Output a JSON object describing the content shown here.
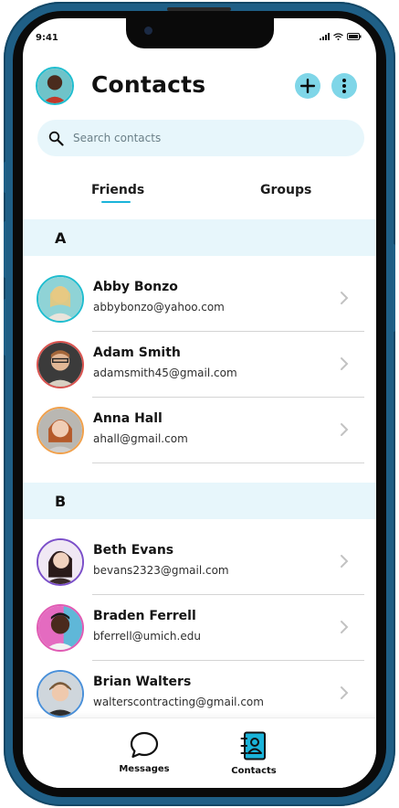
{
  "status_bar": {
    "time": "9:41"
  },
  "header": {
    "title": "Contacts"
  },
  "search": {
    "placeholder": "Search contacts"
  },
  "tabs": [
    {
      "label": "Friends",
      "active": true
    },
    {
      "label": "Groups",
      "active": false
    }
  ],
  "sections": [
    {
      "letter": "A",
      "contacts": [
        {
          "name": "Abby Bonzo",
          "email": "abbybonzo@yahoo.com",
          "ring": "#1fbdcf"
        },
        {
          "name": "Adam Smith",
          "email": "adamsmith45@gmail.com",
          "ring": "#d9534f"
        },
        {
          "name": "Anna Hall",
          "email": "ahall@gmail.com",
          "ring": "#f0a04b"
        }
      ]
    },
    {
      "letter": "B",
      "contacts": [
        {
          "name": "Beth Evans",
          "email": "bevans2323@gmail.com",
          "ring": "#7b4fc9"
        },
        {
          "name": "Braden Ferrell",
          "email": "bferrell@umich.edu",
          "ring": "#e05bb3"
        },
        {
          "name": "Brian Walters",
          "email": "walterscontracting@gmail.com",
          "ring": "#4a90d9"
        }
      ]
    }
  ],
  "bottom_nav": [
    {
      "label": "Messages",
      "icon": "chat-bubble-icon"
    },
    {
      "label": "Contacts",
      "icon": "address-book-icon"
    }
  ],
  "colors": {
    "accent": "#1ab3d9",
    "accent_light": "#7fd6e8",
    "section_bg": "#e7f6fb",
    "frame": "#1f5f86"
  }
}
